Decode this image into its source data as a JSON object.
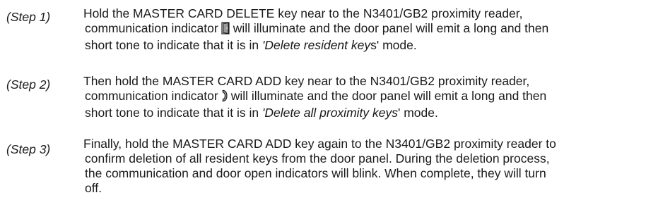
{
  "steps": [
    {
      "label": "(Step 1)",
      "line1": "Hold the MASTER CARD DELETE key near to the N3401/GB2 proximity reader,",
      "line2_before": "communication indicator",
      "line2_after": "will illuminate and the door panel will emit a long and then",
      "line3_before": "short tone to indicate that it is in ",
      "line3_italic": "'Delete resident key",
      "line3_after": "s' mode.",
      "indicator_icon": "communication-indicator-door-icon"
    },
    {
      "label": "(Step 2)",
      "line1": "Then hold the MASTER CARD ADD key near to the N3401/GB2 proximity reader,",
      "line2_before": "communication indicator",
      "line2_after": "will illuminate and the door panel will emit a long and then",
      "line3_before": "short tone to indicate that it is in ",
      "line3_italic": "'Delete all proximity keys",
      "line3_after": "' mode.",
      "indicator_icon": "communication-indicator-handset-icon"
    },
    {
      "label": "(Step 3)",
      "line1": "Finally, hold the MASTER CARD ADD key again to the N3401/GB2 proximity reader to",
      "line2": "confirm deletion of all resident keys from the door panel. During the deletion process,",
      "line3": "the communication and door open indicators will blink. When complete, they will turn",
      "line4": "off."
    }
  ],
  "colors": {
    "text": "#1a1a1a",
    "icon_fill": "#9a9a9a",
    "icon_stroke": "#1a1a1a"
  }
}
